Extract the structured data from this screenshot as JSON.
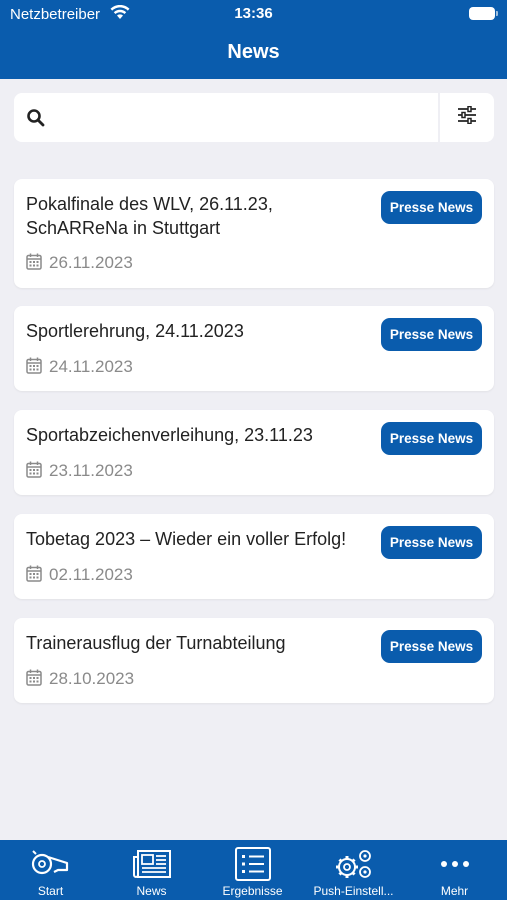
{
  "status_bar": {
    "carrier": "Netzbetreiber",
    "time": "13:36"
  },
  "header": {
    "title": "News"
  },
  "search": {
    "placeholder": "",
    "value": ""
  },
  "news": [
    {
      "title": "Pokalfinale des WLV, 26.11.23, SchARReNa in Stuttgart",
      "badge": "Presse News",
      "date": "26.11.2023"
    },
    {
      "title": "Sportlerehrung, 24.11.2023",
      "badge": "Presse News",
      "date": "24.11.2023"
    },
    {
      "title": "Sportabzeichenverleihung, 23.11.23",
      "badge": "Presse News",
      "date": "23.11.2023"
    },
    {
      "title": "Tobetag 2023 – Wieder ein voller Erfolg!",
      "badge": "Presse News",
      "date": "02.11.2023"
    },
    {
      "title": "Trainerausflug der Turnabteilung",
      "badge": "Presse News",
      "date": "28.10.2023"
    }
  ],
  "tabbar": {
    "items": [
      {
        "label": "Start",
        "icon": "whistle-icon"
      },
      {
        "label": "News",
        "icon": "newspaper-icon"
      },
      {
        "label": "Ergebnisse",
        "icon": "list-icon"
      },
      {
        "label": "Push-Einstell...",
        "icon": "gears-icon"
      },
      {
        "label": "Mehr",
        "icon": "more-icon"
      }
    ]
  },
  "colors": {
    "primary": "#0a5cad",
    "background": "#efeff4"
  }
}
